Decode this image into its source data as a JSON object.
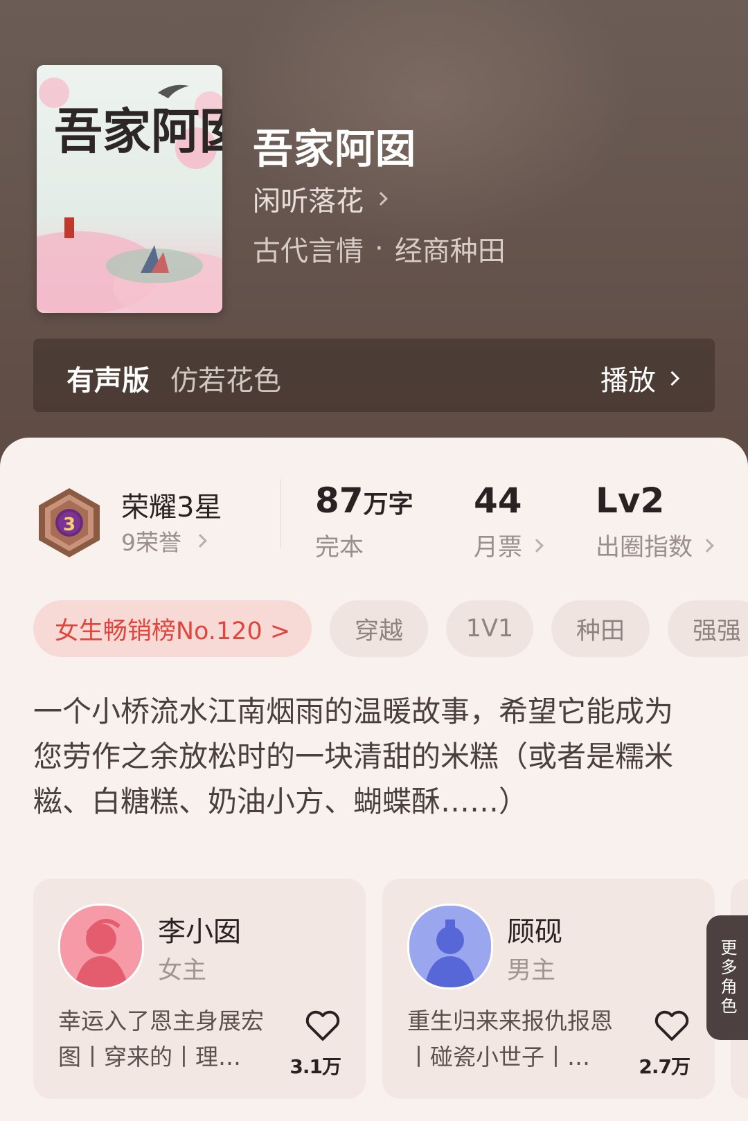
{
  "book": {
    "title": "吾家阿囡",
    "author": "闲听落花",
    "genre1": "古代言情",
    "dot": "·",
    "genre2": "经商种田",
    "cover_text": "吾家阿囡"
  },
  "audio": {
    "label": "有声版",
    "subtitle": "仿若花色",
    "play": "播放"
  },
  "honor": {
    "title": "荣耀3星",
    "sub": "9荣誉",
    "badge_num": "3"
  },
  "stats": {
    "words_num": "87",
    "words_unit": "万字",
    "words_label": "完本",
    "votes_num": "44",
    "votes_label": "月票",
    "index_num": "Lv2",
    "index_label": "出圈指数"
  },
  "tags": [
    "女生畅销榜No.120 >",
    "穿越",
    "1V1",
    "种田",
    "强强"
  ],
  "description": "一个小桥流水江南烟雨的温暖故事，希望它能成为您劳作之余放松时的一块清甜的米糕（或者是糯米糍、白糖糕、奶油小方、蝴蝶酥……）",
  "characters": [
    {
      "name": "李小囡",
      "role": "女主",
      "desc": "幸运入了恩主身展宏图丨穿来的丨理…",
      "likes": "3.1万"
    },
    {
      "name": "顾砚",
      "role": "男主",
      "desc": "重生归来来报仇报恩丨碰瓷小世子丨…",
      "likes": "2.7万"
    }
  ],
  "more_roles": "更多角色",
  "colors": {
    "accent_red": "#e0463d",
    "tag_bg": "#efe4e0",
    "hero_bg": "#65554e"
  }
}
